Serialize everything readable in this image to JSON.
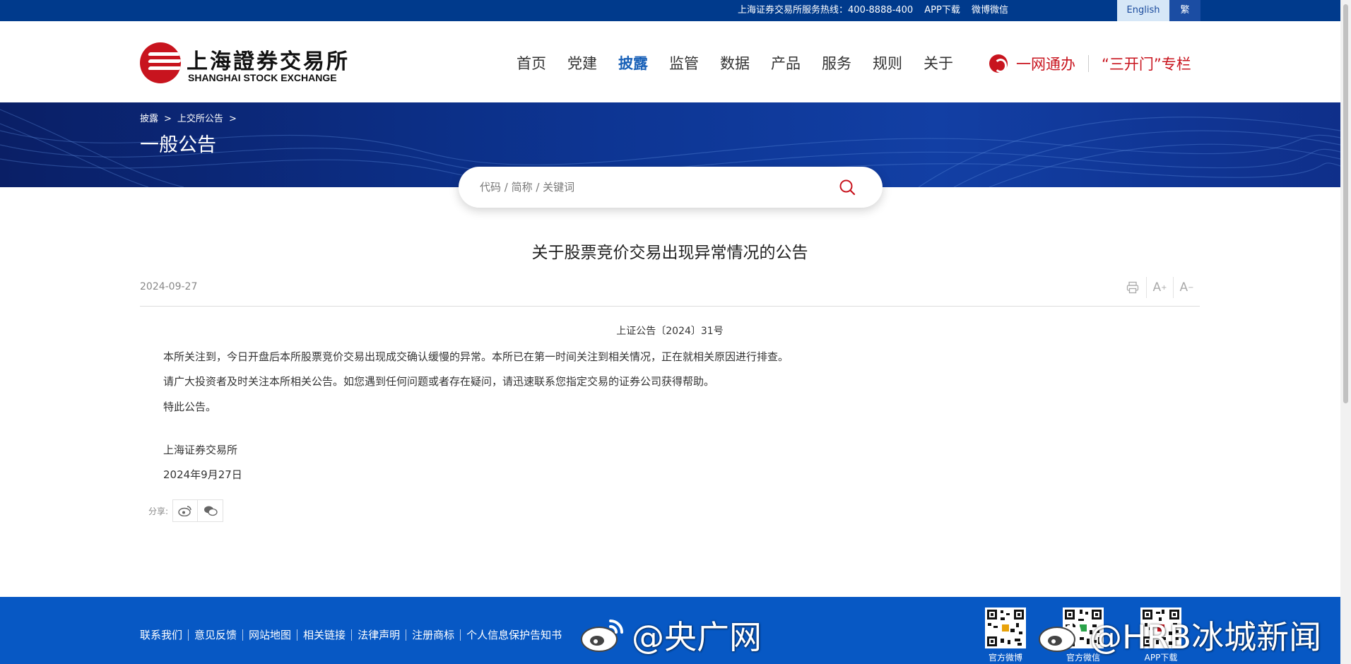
{
  "topbar": {
    "hotline": "上海证券交易所服务热线：400-8888-400",
    "app_download": "APP下载",
    "weibo_wechat": "微博微信",
    "lang_en": "English",
    "lang_tc": "繁"
  },
  "logo": {
    "cn": "上海證券交易所",
    "en": "SHANGHAI STOCK EXCHANGE"
  },
  "nav": [
    {
      "label": "首页"
    },
    {
      "label": "党建"
    },
    {
      "label": "披露"
    },
    {
      "label": "监管"
    },
    {
      "label": "数据"
    },
    {
      "label": "产品"
    },
    {
      "label": "服务"
    },
    {
      "label": "规则"
    },
    {
      "label": "关于"
    }
  ],
  "nav_active": "披露",
  "quicklinks": {
    "one_stop": "一网通办",
    "three_open": "“三开门”专栏"
  },
  "breadcrumb": [
    "披露",
    "上交所公告"
  ],
  "page_title": "一般公告",
  "search": {
    "placeholder": "代码 / 简称 / 关键词"
  },
  "article": {
    "title": "关于股票竞价交易出现异常情况的公告",
    "date": "2024-09-27",
    "doc_no": "上证公告〔2024〕31号",
    "paragraphs": [
      "本所关注到，今日开盘后本所股票竞价交易出现成交确认缓慢的异常。本所已在第一时间关注到相关情况，正在就相关原因进行排查。",
      "请广大投资者及时关注本所相关公告。如您遇到任何问题或者存在疑问，请迅速联系您指定交易的证券公司获得帮助。",
      "特此公告。"
    ],
    "signature": "上海证券交易所",
    "sign_date": "2024年9月27日"
  },
  "tools": {
    "font_larger": "A",
    "font_smaller": "A"
  },
  "share_label": "分享:",
  "footer": {
    "links": [
      "联系我们",
      "意见反馈",
      "网站地图",
      "相关链接",
      "法律声明",
      "注册商标",
      "个人信息保护告知书"
    ],
    "qr": [
      {
        "caption": "官方微博"
      },
      {
        "caption": "官方微信"
      },
      {
        "caption": "APP下载"
      }
    ]
  },
  "watermarks": {
    "left": "@央广网",
    "right": "@HRB冰城新闻"
  },
  "colors": {
    "topbar": "#003a8c",
    "banner": "#0d3593",
    "accent_red": "#c8141e",
    "nav_active": "#1961b8",
    "footer": "#0758c4"
  }
}
